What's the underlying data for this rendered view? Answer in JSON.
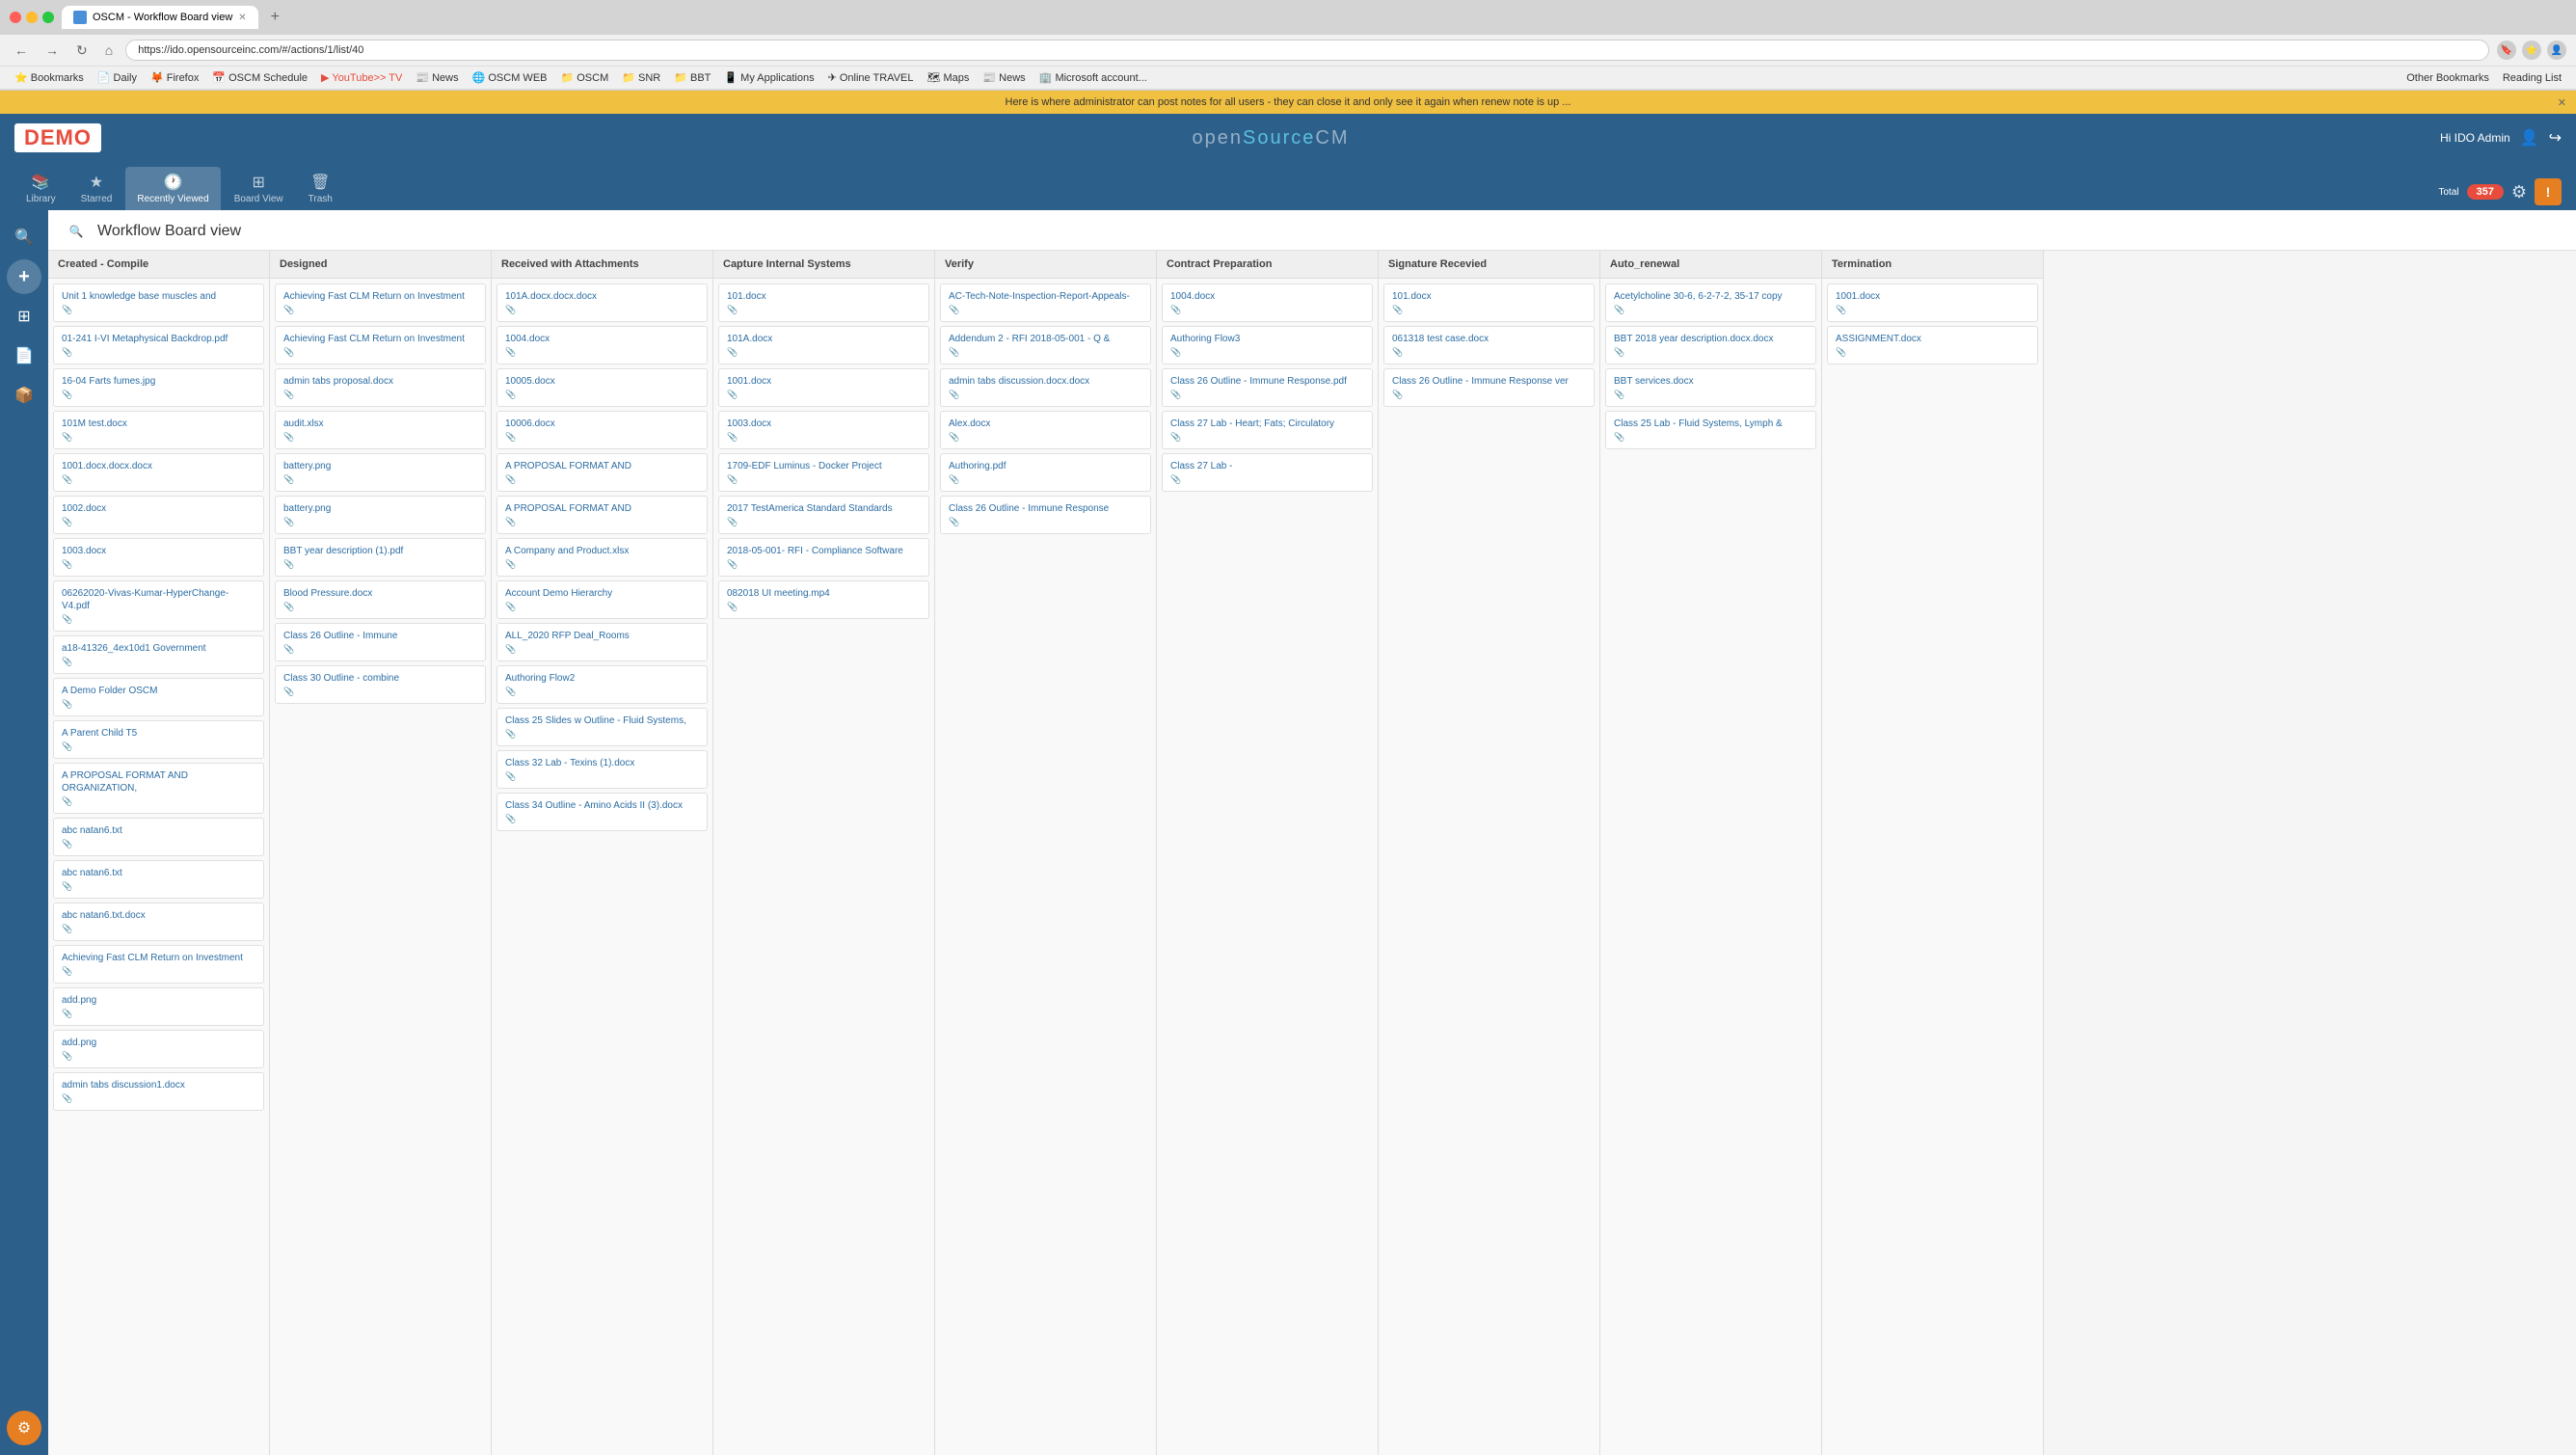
{
  "browser": {
    "tab_title": "OSCM - Workflow Board view",
    "url": "https://ido.opensourceinc.com/#/actions/1/list/40",
    "tab_new_label": "+",
    "nav": {
      "back": "←",
      "forward": "→",
      "reload": "↻",
      "home": "⌂"
    }
  },
  "bookmarks": [
    {
      "label": "Bookmarks",
      "icon_color": "#666"
    },
    {
      "label": "Daily",
      "icon_color": "#4a90d9"
    },
    {
      "label": "Firefox",
      "icon_color": "#e67e22"
    },
    {
      "label": "OSCM Schedule",
      "icon_color": "#27ae60"
    },
    {
      "label": "YouTube>> TV",
      "icon_color": "#e74c3c"
    },
    {
      "label": "News",
      "icon_color": "#2980b9"
    },
    {
      "label": "OSCM WEB",
      "icon_color": "#2c5f8a"
    },
    {
      "label": "OSCM",
      "icon_color": "#2c5f8a"
    },
    {
      "label": "SNR",
      "icon_color": "#8e44ad"
    },
    {
      "label": "BBT",
      "icon_color": "#27ae60"
    },
    {
      "label": "My Applications",
      "icon_color": "#e67e22"
    },
    {
      "label": "Online TRAVEL",
      "icon_color": "#16a085"
    },
    {
      "label": "Maps",
      "icon_color": "#2ecc71"
    },
    {
      "label": "News",
      "icon_color": "#2980b9"
    },
    {
      "label": "Microsoft account...",
      "icon_color": "#e74c3c"
    },
    {
      "label": "Other Bookmarks",
      "icon_color": "#999"
    },
    {
      "label": "Reading List",
      "icon_color": "#999"
    }
  ],
  "notification": {
    "text": "Here is where administrator can post notes for all users - they can close it and only see it again when renew note is up ..."
  },
  "header": {
    "logo": "DEMO",
    "brand": "openSourceCM",
    "user_greeting": "Hi IDO Admin"
  },
  "toolbar": {
    "tabs": [
      {
        "id": "library",
        "label": "Library",
        "icon": "📚"
      },
      {
        "id": "starred",
        "label": "Starred",
        "icon": "★"
      },
      {
        "id": "recently_viewed",
        "label": "Recently Viewed",
        "icon": "🕐"
      },
      {
        "id": "board_view",
        "label": "Board View",
        "icon": "⊞"
      },
      {
        "id": "trash",
        "label": "Trash",
        "icon": "🗑"
      }
    ],
    "active_tab": "board_view",
    "total_label": "Total",
    "total_count": "357"
  },
  "page": {
    "title": "Workflow Board view"
  },
  "columns": [
    {
      "id": "created_compile",
      "header": "Created - Compile",
      "cards": [
        {
          "title": "Unit 1 knowledge base muscles and",
          "has_icon": true
        },
        {
          "title": "01-241 I-VI Metaphysical Backdrop.pdf",
          "has_icon": true
        },
        {
          "title": "16-04 Farts fumes.jpg",
          "has_icon": true
        },
        {
          "title": "101M test.docx",
          "has_icon": true
        },
        {
          "title": "1001.docx.docx.docx",
          "has_icon": true
        },
        {
          "title": "1002.docx",
          "has_icon": true
        },
        {
          "title": "1003.docx",
          "has_icon": true
        },
        {
          "title": "06262020-Vivas-Kumar-HyperChange-V4.pdf",
          "has_icon": true
        },
        {
          "title": "a18-41326_4ex10d1 Government",
          "has_icon": true
        },
        {
          "title": "A Demo Folder OSCM",
          "has_icon": true
        },
        {
          "title": "A Parent Child T5",
          "has_icon": true
        },
        {
          "title": "A PROPOSAL FORMAT AND ORGANIZATION,",
          "has_icon": true
        },
        {
          "title": "abc natan6.txt",
          "has_icon": true
        },
        {
          "title": "abc natan6.txt",
          "has_icon": true
        },
        {
          "title": "abc natan6.txt.docx",
          "has_icon": true
        },
        {
          "title": "Achieving Fast CLM Return on Investment",
          "has_icon": true
        },
        {
          "title": "add.png",
          "has_icon": true
        },
        {
          "title": "add.png",
          "has_icon": true
        },
        {
          "title": "admin tabs discussion1.docx",
          "has_icon": true
        }
      ]
    },
    {
      "id": "designed",
      "header": "Designed",
      "cards": [
        {
          "title": "Achieving Fast CLM Return on Investment",
          "has_icon": true
        },
        {
          "title": "Achieving Fast CLM Return on Investment",
          "has_icon": true
        },
        {
          "title": "admin tabs proposal.docx",
          "has_icon": true
        },
        {
          "title": "audit.xlsx",
          "has_icon": true
        },
        {
          "title": "battery.png",
          "has_icon": true
        },
        {
          "title": "battery.png",
          "has_icon": true
        },
        {
          "title": "BBT year description (1).pdf",
          "has_icon": true
        },
        {
          "title": "Blood Pressure.docx",
          "has_icon": true
        },
        {
          "title": "Class 26 Outline - Immune",
          "has_icon": true
        },
        {
          "title": "Class 30 Outline - combine",
          "has_icon": true
        }
      ]
    },
    {
      "id": "received_attachments",
      "header": "Received with Attachments",
      "cards": [
        {
          "title": "101A.docx.docx.docx",
          "has_icon": true
        },
        {
          "title": "1004.docx",
          "has_icon": true
        },
        {
          "title": "10005.docx",
          "has_icon": true
        },
        {
          "title": "10006.docx",
          "has_icon": true
        },
        {
          "title": "A PROPOSAL FORMAT AND",
          "has_icon": true
        },
        {
          "title": "A PROPOSAL FORMAT AND",
          "has_icon": true
        },
        {
          "title": "A Company and Product.xlsx",
          "has_icon": true
        },
        {
          "title": "Account Demo Hierarchy",
          "has_icon": true
        },
        {
          "title": "ALL_2020 RFP Deal_Rooms",
          "has_icon": true
        },
        {
          "title": "Authoring Flow2",
          "has_icon": true
        },
        {
          "title": "Class 25 Slides w Outline - Fluid Systems,",
          "has_icon": true
        },
        {
          "title": "Class 32 Lab - Texins (1).docx",
          "has_icon": true
        },
        {
          "title": "Class 34 Outline - Amino Acids II (3).docx",
          "has_icon": true
        }
      ]
    },
    {
      "id": "capture_internal",
      "header": "Capture Internal Systems",
      "cards": [
        {
          "title": "101.docx",
          "has_icon": true
        },
        {
          "title": "101A.docx",
          "has_icon": true
        },
        {
          "title": "1001.docx",
          "has_icon": true
        },
        {
          "title": "1003.docx",
          "has_icon": true
        },
        {
          "title": "1709-EDF Luminus - Docker Project",
          "has_icon": true
        },
        {
          "title": "2017 TestAmerica Standard Standards",
          "has_icon": true
        },
        {
          "title": "2018-05-001- RFI - Compliance Software",
          "has_icon": true
        },
        {
          "title": "082018 UI meeting.mp4",
          "has_icon": true
        }
      ]
    },
    {
      "id": "verify",
      "header": "Verify",
      "cards": [
        {
          "title": "AC-Tech-Note-Inspection-Report-Appeals-",
          "has_icon": true
        },
        {
          "title": "Addendum 2 - RFI 2018-05-001 - Q &",
          "has_icon": true
        },
        {
          "title": "admin tabs discussion.docx.docx",
          "has_icon": true
        },
        {
          "title": "Alex.docx",
          "has_icon": true
        },
        {
          "title": "Authoring.pdf",
          "has_icon": true
        },
        {
          "title": "Class 26 Outline - Immune Response",
          "has_icon": true
        }
      ]
    },
    {
      "id": "contract_preparation",
      "header": "Contract Preparation",
      "cards": [
        {
          "title": "1004.docx",
          "has_icon": true
        },
        {
          "title": "Authoring Flow3",
          "has_icon": true
        },
        {
          "title": "Class 26 Outline - Immune Response.pdf",
          "has_icon": true
        },
        {
          "title": "Class 27 Lab - Heart; Fats; Circulatory",
          "has_icon": true
        },
        {
          "title": "Class 27 Lab -",
          "has_icon": true
        }
      ]
    },
    {
      "id": "signature_received",
      "header": "Signature Recevied",
      "cards": [
        {
          "title": "101.docx",
          "has_icon": true
        },
        {
          "title": "061318 test case.docx",
          "has_icon": true
        },
        {
          "title": "Class 26 Outline - Immune Response ver",
          "has_icon": true
        }
      ]
    },
    {
      "id": "auto_renewal",
      "header": "Auto_renewal",
      "cards": [
        {
          "title": "Acetylcholine 30-6, 6-2-7-2, 35-17 copy",
          "has_icon": true
        },
        {
          "title": "BBT 2018 year description.docx.docx",
          "has_icon": true
        },
        {
          "title": "BBT services.docx",
          "has_icon": true
        },
        {
          "title": "Class 25 Lab - Fluid Systems, Lymph &",
          "has_icon": true
        }
      ]
    },
    {
      "id": "termination",
      "header": "Termination",
      "cards": [
        {
          "title": "1001.docx",
          "has_icon": true
        },
        {
          "title": "ASSIGNMENT.docx",
          "has_icon": true
        }
      ]
    }
  ],
  "sidebar_icons": [
    {
      "id": "search",
      "symbol": "🔍",
      "active": false
    },
    {
      "id": "add",
      "symbol": "+",
      "active": false
    },
    {
      "id": "grid",
      "symbol": "⊞",
      "active": false
    },
    {
      "id": "doc",
      "symbol": "📄",
      "active": false
    },
    {
      "id": "box",
      "symbol": "📦",
      "active": false
    },
    {
      "id": "gear",
      "symbol": "⚙",
      "active": true,
      "special": true
    }
  ]
}
